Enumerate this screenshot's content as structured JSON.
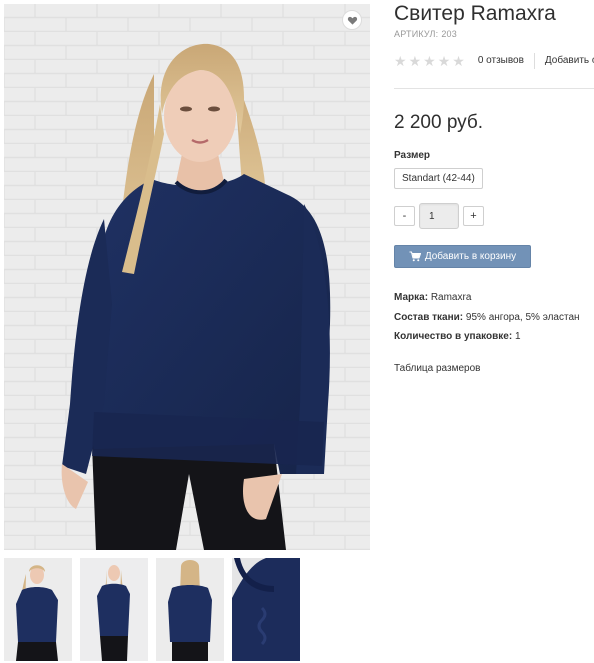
{
  "product": {
    "title": "Свитер Ramaxra",
    "sku_label": "АРТИКУЛ:",
    "sku_value": "203",
    "rating_stars": 0,
    "reviews_text": "0 отзывов",
    "add_review_text": "Добавить отзыв",
    "price": "2 200 руб.",
    "size_label": "Размер",
    "size_option": "Standart (42-44)",
    "qty_minus": "-",
    "qty_value": "1",
    "qty_plus": "+",
    "cart_button": "Добавить в корзину",
    "props": [
      {
        "label": "Марка:",
        "value": "Ramaxra"
      },
      {
        "label": "Состав ткани:",
        "value": "95% ангора, 5% эластан"
      },
      {
        "label": "Количество в упаковке:",
        "value": "1"
      }
    ],
    "size_table_link": "Таблица размеров"
  },
  "gallery": {
    "thumbnails": [
      "front",
      "front-full",
      "back",
      "detail"
    ]
  },
  "icons": {
    "wishlist": "heart-icon",
    "cart": "cart-icon",
    "star": "star-icon"
  },
  "colors": {
    "sweater": "#1c2d58",
    "cart_button": "#7292b7",
    "star_empty": "#d9d9d9"
  }
}
